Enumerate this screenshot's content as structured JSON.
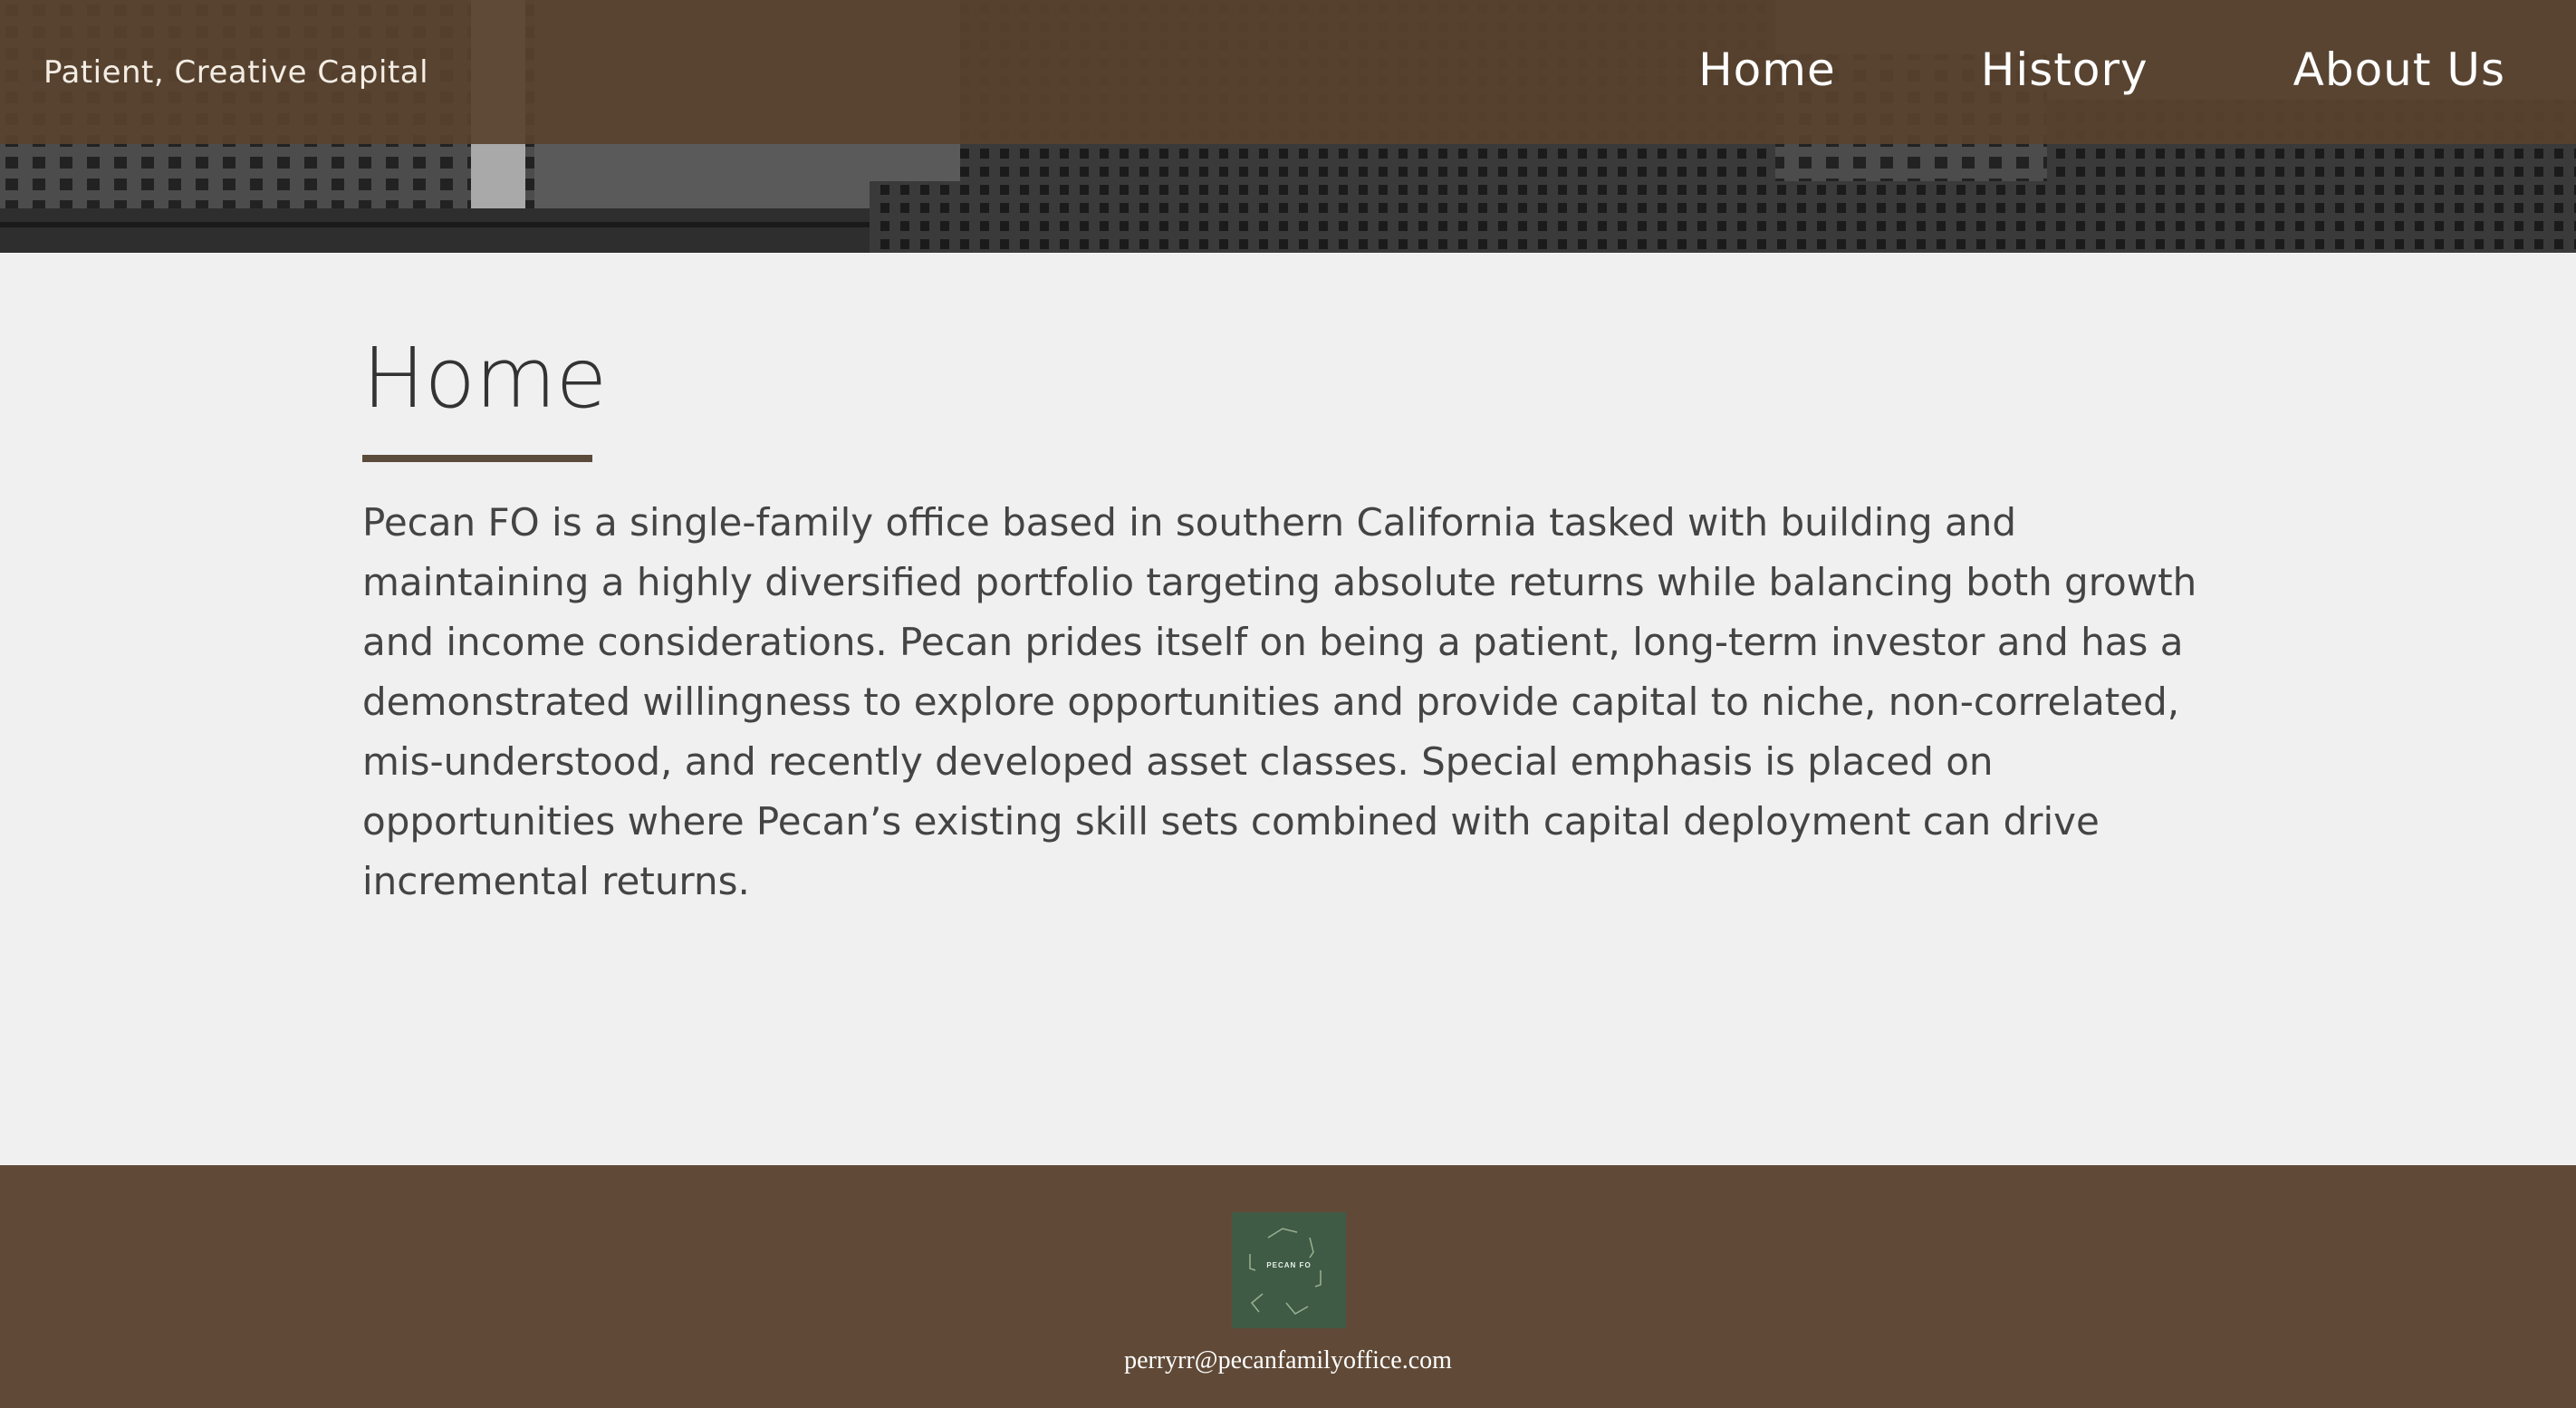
{
  "header": {
    "tagline": "Patient, Creative Capital",
    "nav": [
      {
        "label": "Home"
      },
      {
        "label": "History"
      },
      {
        "label": "About Us"
      }
    ]
  },
  "main": {
    "title": "Home",
    "paragraph": "Pecan FO is a single-family office based in southern California tasked with building and maintaining a highly diversified portfolio targeting absolute returns while balancing both growth and income considerations. Pecan prides itself on being a patient, long-term investor and has a demonstrated willingness to explore opportunities and provide capital to niche, non-correlated, mis-understood, and recently developed asset classes. Special emphasis is placed on opportunities where Pecan’s existing skill sets combined with capital deployment can drive incremental returns."
  },
  "footer": {
    "logo_text": "PECAN FO",
    "email": "perryrr@pecanfamilyoffice.com"
  },
  "colors": {
    "header_overlay": "#58422e",
    "footer_bg": "#604a37",
    "title_rule": "#5c4a3a",
    "logo_bg": "#3f5b46",
    "page_bg": "#f0f0f0"
  }
}
